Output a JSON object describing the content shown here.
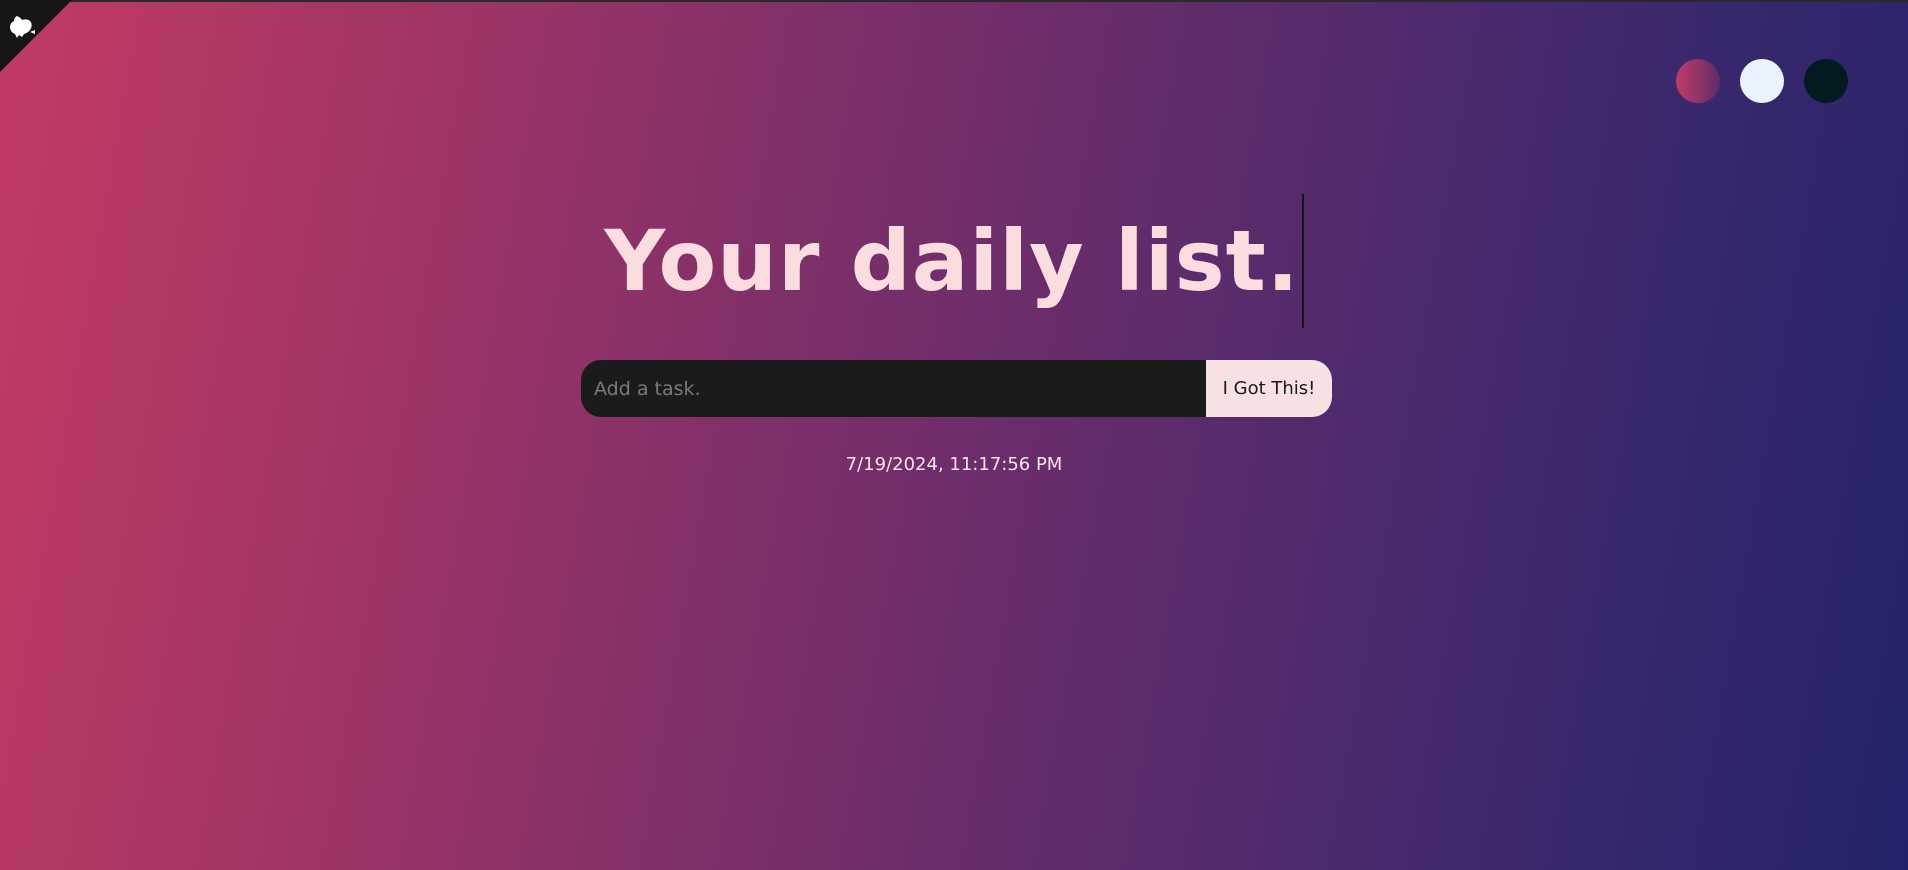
{
  "header": {
    "title": "Your daily list."
  },
  "corner": {
    "icon": "github-icon"
  },
  "themes": [
    {
      "name": "gradient",
      "color": "#c23a66"
    },
    {
      "name": "light",
      "color": "#e7f3fd"
    },
    {
      "name": "dark",
      "color": "#031a20"
    }
  ],
  "form": {
    "input_value": "",
    "input_placeholder": "Add a task.",
    "submit_label": "I Got This!"
  },
  "datetime": "7/19/2024, 11:17:56 PM",
  "colors": {
    "background_start": "#c23a66",
    "background_end": "#22246b",
    "title": "#fbdcdf",
    "input_bg": "#1b1b1b",
    "button_bg": "#f7e1e3"
  }
}
